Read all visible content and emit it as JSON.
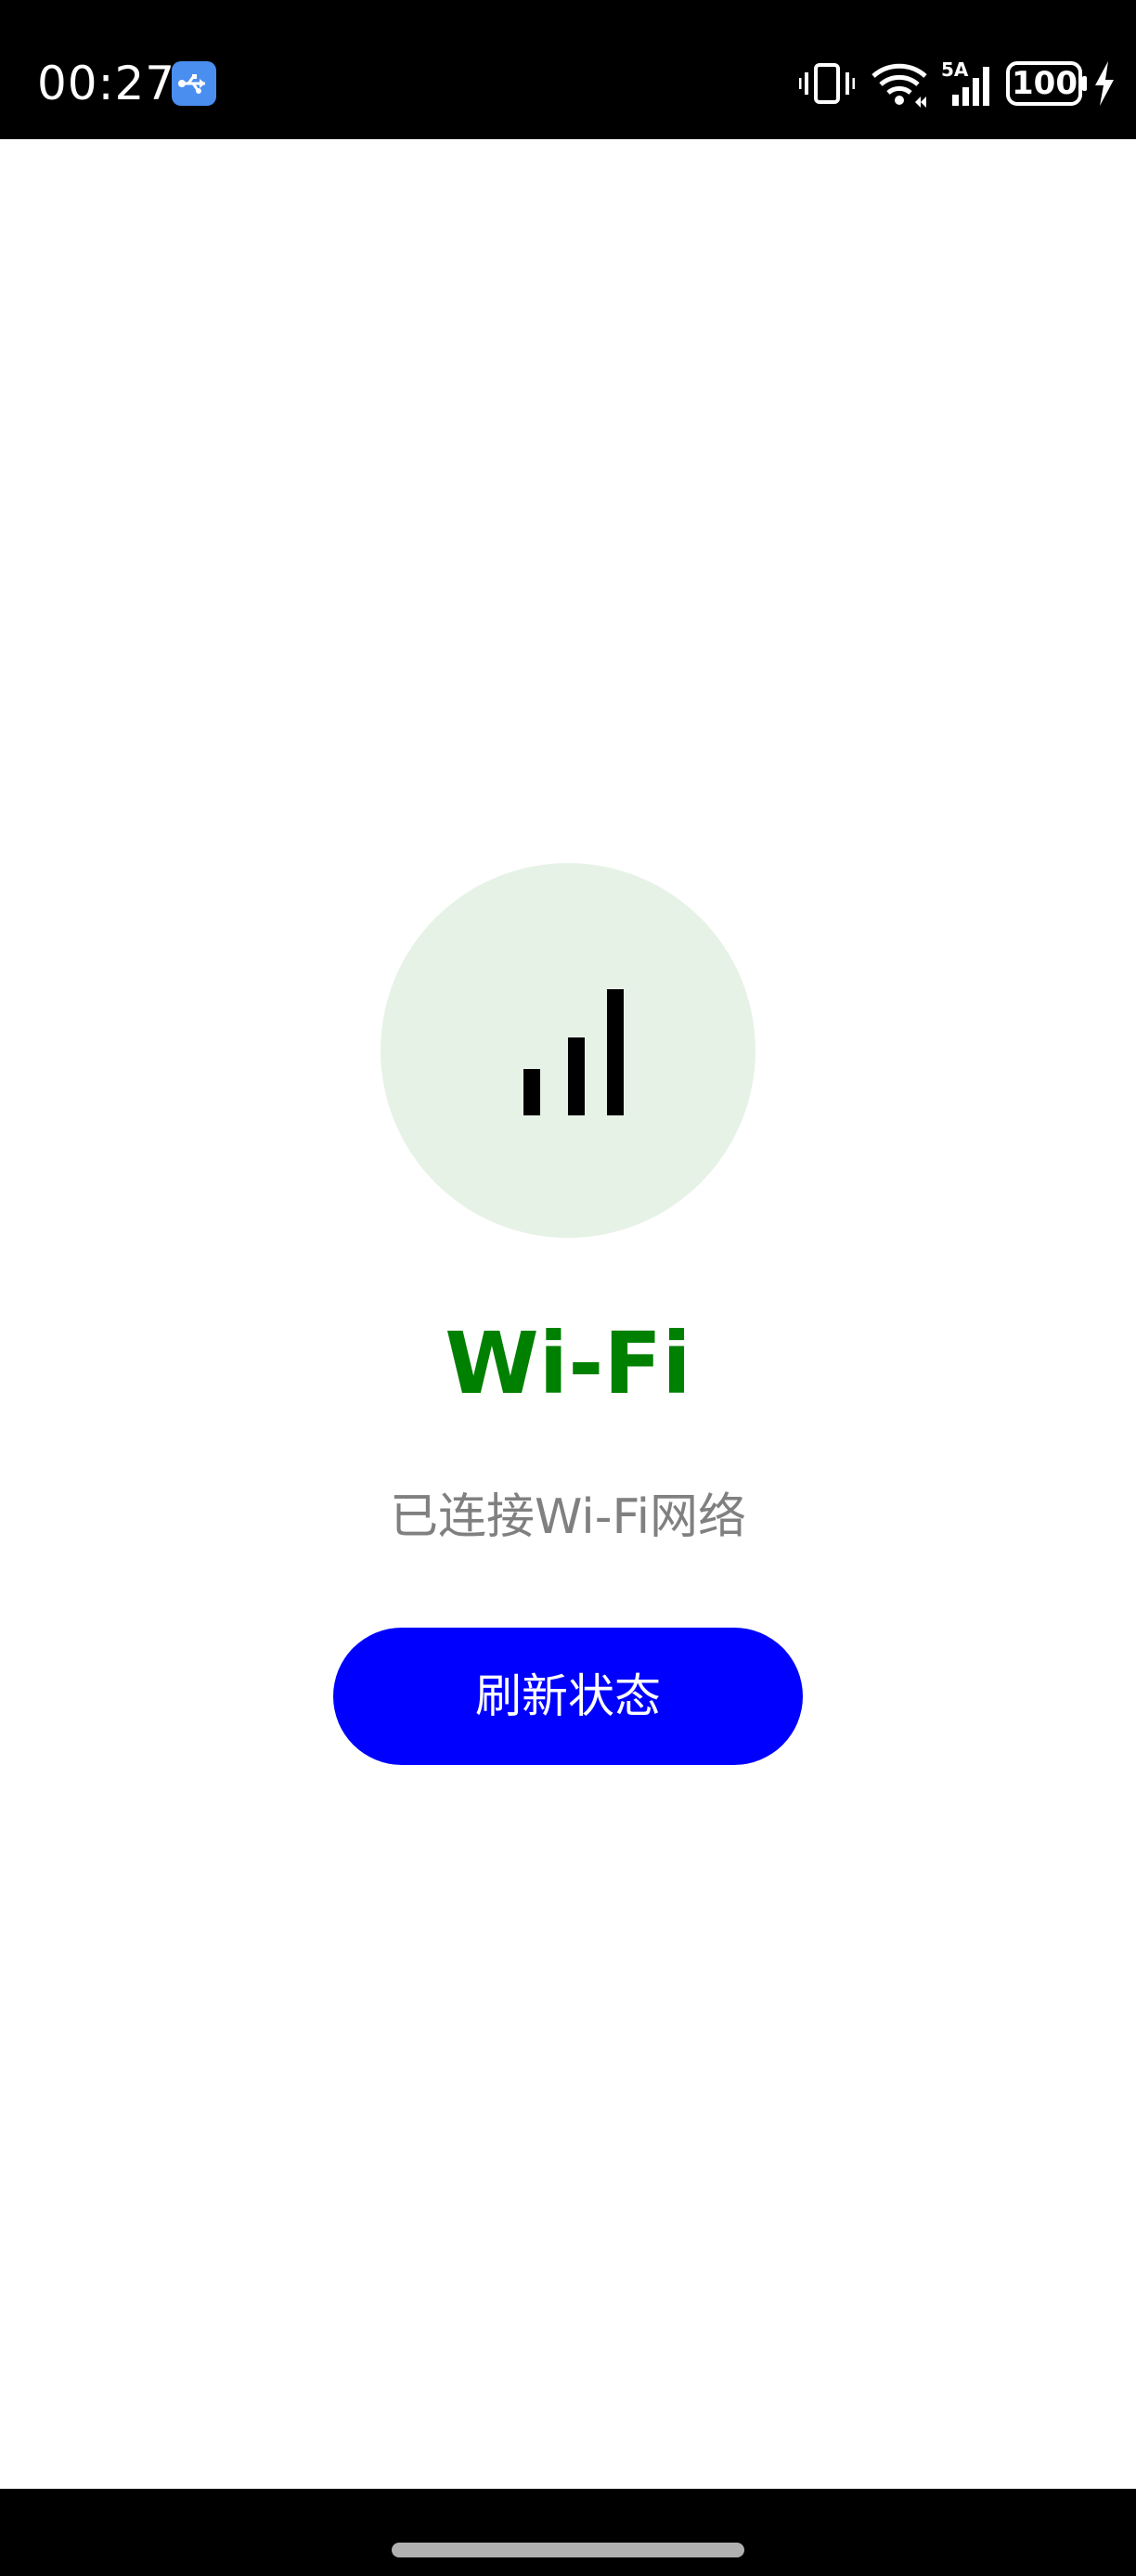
{
  "status_bar": {
    "time": "00:27",
    "battery": "100",
    "network_label": "5A",
    "icons": [
      "usb-icon",
      "vibrate-icon",
      "wifi-icon",
      "cellular-signal-icon",
      "battery-icon",
      "charging-icon"
    ]
  },
  "main": {
    "icon": "signal-bars-icon",
    "title": "Wi-Fi",
    "status": "已连接Wi-Fi网络",
    "refresh_label": "刷新状态"
  },
  "colors": {
    "title": "#008000",
    "status_text": "#808080",
    "button_bg": "#0000ff",
    "circle_bg": "#e7f2e7"
  }
}
